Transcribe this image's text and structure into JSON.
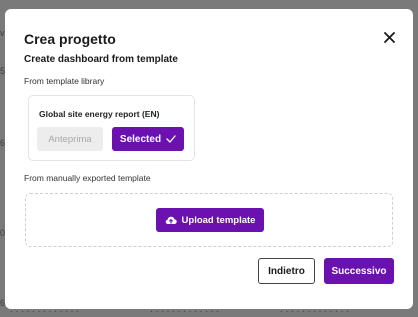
{
  "modal": {
    "title": "Crea progetto",
    "subtitle": "Create dashboard from template",
    "library_label": "From template library",
    "template": {
      "name": "Global site energy report (EN)",
      "preview_label": "Anteprima",
      "selected_label": "Selected"
    },
    "manual_label": "From manually exported template",
    "upload_label": "Upload template",
    "back_label": "Indietro",
    "next_label": "Successivo"
  },
  "colors": {
    "accent": "#6a11b0",
    "disabled_bg": "#ededed",
    "disabled_text": "#a8a8a8"
  },
  "icons": {
    "close": "close-icon",
    "check": "check-icon",
    "upload": "cloud-upload-icon"
  }
}
